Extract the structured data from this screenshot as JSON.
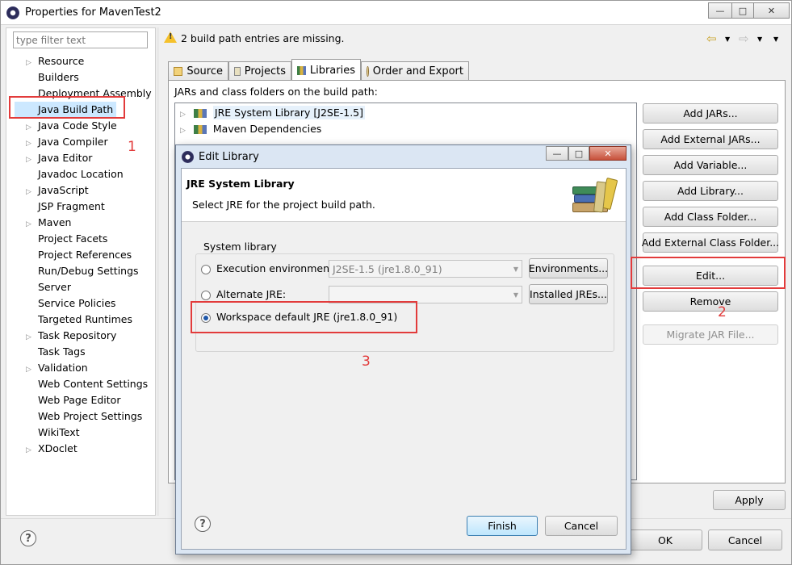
{
  "window": {
    "title": "Properties for MavenTest2"
  },
  "filter": {
    "placeholder": "type filter text"
  },
  "nav_items": [
    {
      "label": "Resource",
      "expandable": true
    },
    {
      "label": "Builders",
      "expandable": false
    },
    {
      "label": "Deployment Assembly",
      "expandable": false
    },
    {
      "label": "Java Build Path",
      "expandable": false,
      "selected": true
    },
    {
      "label": "Java Code Style",
      "expandable": true
    },
    {
      "label": "Java Compiler",
      "expandable": true
    },
    {
      "label": "Java Editor",
      "expandable": true
    },
    {
      "label": "Javadoc Location",
      "expandable": false
    },
    {
      "label": "JavaScript",
      "expandable": true
    },
    {
      "label": "JSP Fragment",
      "expandable": false
    },
    {
      "label": "Maven",
      "expandable": true
    },
    {
      "label": "Project Facets",
      "expandable": false
    },
    {
      "label": "Project References",
      "expandable": false
    },
    {
      "label": "Run/Debug Settings",
      "expandable": false
    },
    {
      "label": "Server",
      "expandable": false
    },
    {
      "label": "Service Policies",
      "expandable": false
    },
    {
      "label": "Targeted Runtimes",
      "expandable": false
    },
    {
      "label": "Task Repository",
      "expandable": true
    },
    {
      "label": "Task Tags",
      "expandable": false
    },
    {
      "label": "Validation",
      "expandable": true
    },
    {
      "label": "Web Content Settings",
      "expandable": false
    },
    {
      "label": "Web Page Editor",
      "expandable": false
    },
    {
      "label": "Web Project Settings",
      "expandable": false
    },
    {
      "label": "WikiText",
      "expandable": false
    },
    {
      "label": "XDoclet",
      "expandable": true
    }
  ],
  "message": {
    "text": "2 build path entries are missing."
  },
  "tabs": [
    {
      "label": "Source"
    },
    {
      "label": "Projects"
    },
    {
      "label": "Libraries",
      "active": true
    },
    {
      "label": "Order and Export"
    }
  ],
  "libraries": {
    "caption": "JARs and class folders on the build path:",
    "entries": [
      "JRE System Library [J2SE-1.5]",
      "Maven Dependencies"
    ]
  },
  "side_buttons": {
    "add_jars": "Add JARs...",
    "add_external_jars": "Add External JARs...",
    "add_variable": "Add Variable...",
    "add_library": "Add Library...",
    "add_class_folder": "Add Class Folder...",
    "add_external_class_folder": "Add External Class Folder...",
    "edit": "Edit...",
    "remove": "Remove",
    "migrate": "Migrate JAR File..."
  },
  "bottom": {
    "apply": "Apply",
    "ok": "OK",
    "cancel": "Cancel"
  },
  "dialog": {
    "title": "Edit Library",
    "heading": "JRE System Library",
    "description": "Select JRE for the project build path.",
    "group_label": "System library",
    "execution_env_label": "Execution environment:",
    "execution_env_value": "J2SE-1.5 (jre1.8.0_91)",
    "environments_button": "Environments...",
    "alternate_jre_label": "Alternate JRE:",
    "alternate_jre_value": "",
    "installed_jres_button": "Installed JREs...",
    "workspace_default_label": "Workspace default JRE (jre1.8.0_91)",
    "finish": "Finish",
    "cancel": "Cancel"
  },
  "annotations": {
    "one": "1",
    "two": "2",
    "three": "3"
  },
  "colors": {
    "annotation_red": "#e23b3b",
    "selection": "#cce8ff",
    "accent": "#3c7fb1"
  }
}
